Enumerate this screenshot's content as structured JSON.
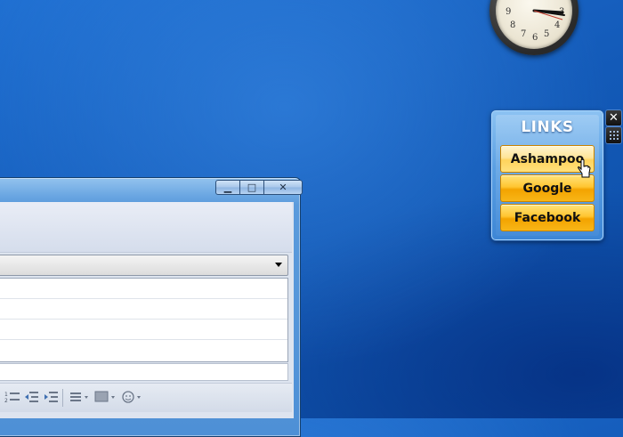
{
  "gadget": {
    "title": "LINKS",
    "buttons": [
      {
        "label": "Ashampoo",
        "hovered": true
      },
      {
        "label": "Google",
        "hovered": false
      },
      {
        "label": "Facebook",
        "hovered": false
      }
    ],
    "close_glyph": "✕"
  },
  "clock": {
    "visible_numerals": [
      "9",
      "8",
      "7",
      "6",
      "5",
      "4",
      "3"
    ]
  },
  "window": {
    "controls": {
      "minimize": "▁",
      "maximize": "□",
      "close": "✕"
    }
  },
  "colors": {
    "desktop": "#135ab8",
    "gadget_button": "#ffc531",
    "window_frame": "#5b9bdc"
  }
}
